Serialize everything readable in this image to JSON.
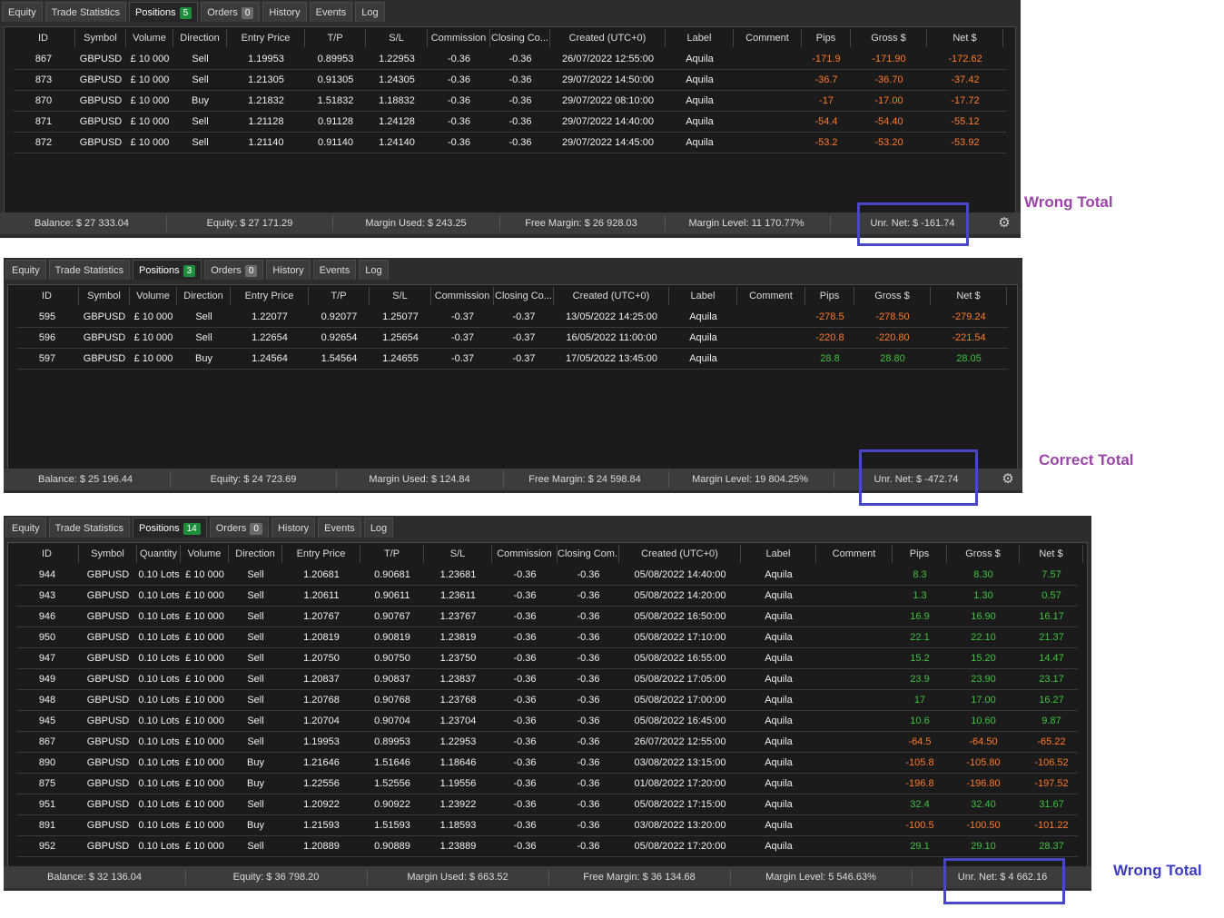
{
  "tab_labels": [
    "Equity",
    "Trade Statistics",
    "Positions",
    "Orders",
    "History",
    "Events",
    "Log"
  ],
  "panels": [
    {
      "positions_count": "5",
      "orders_count": "0",
      "columns": [
        "ID",
        "Symbol",
        "Volume",
        "Direction",
        "Entry Price",
        "T/P",
        "S/L",
        "Commission",
        "Closing Co...",
        "Created (UTC+0)",
        "Label",
        "Comment",
        "Pips",
        "Gross $",
        "Net $"
      ],
      "rows": [
        [
          "867",
          "GBPUSD",
          "£ 10 000",
          "Sell",
          "1.19953",
          "0.89953",
          "1.22953",
          "-0.36",
          "-0.36",
          "26/07/2022 12:55:00",
          "Aquila",
          "",
          "-171.9",
          "-171.90",
          "-172.62"
        ],
        [
          "873",
          "GBPUSD",
          "£ 10 000",
          "Sell",
          "1.21305",
          "0.91305",
          "1.24305",
          "-0.36",
          "-0.36",
          "29/07/2022 14:50:00",
          "Aquila",
          "",
          "-36.7",
          "-36.70",
          "-37.42"
        ],
        [
          "870",
          "GBPUSD",
          "£ 10 000",
          "Buy",
          "1.21832",
          "1.51832",
          "1.18832",
          "-0.36",
          "-0.36",
          "29/07/2022 08:10:00",
          "Aquila",
          "",
          "-17",
          "-17.00",
          "-17.72"
        ],
        [
          "871",
          "GBPUSD",
          "£ 10 000",
          "Sell",
          "1.21128",
          "0.91128",
          "1.24128",
          "-0.36",
          "-0.36",
          "29/07/2022 14:40:00",
          "Aquila",
          "",
          "-54.4",
          "-54.40",
          "-55.12"
        ],
        [
          "872",
          "GBPUSD",
          "£ 10 000",
          "Sell",
          "1.21140",
          "0.91140",
          "1.24140",
          "-0.36",
          "-0.36",
          "29/07/2022 14:45:00",
          "Aquila",
          "",
          "-53.2",
          "-53.20",
          "-53.92"
        ]
      ],
      "status": [
        "Balance: $ 27 333.04",
        "Equity: $ 27 171.29",
        "Margin Used: $ 243.25",
        "Free Margin: $ 26 928.03",
        "Margin Level: 11 170.77%",
        "Unr. Net: $ -161.74"
      ],
      "annotation": "Wrong Total",
      "annotation_color": "#9b45a8"
    },
    {
      "positions_count": "3",
      "orders_count": "0",
      "columns": [
        "ID",
        "Symbol",
        "Volume",
        "Direction",
        "Entry Price",
        "T/P",
        "S/L",
        "Commission",
        "Closing Co...",
        "Created (UTC+0)",
        "Label",
        "Comment",
        "Pips",
        "Gross $",
        "Net $"
      ],
      "rows": [
        [
          "595",
          "GBPUSD",
          "£ 10 000",
          "Sell",
          "1.22077",
          "0.92077",
          "1.25077",
          "-0.37",
          "-0.37",
          "13/05/2022 14:25:00",
          "Aquila",
          "",
          "-278.5",
          "-278.50",
          "-279.24"
        ],
        [
          "596",
          "GBPUSD",
          "£ 10 000",
          "Sell",
          "1.22654",
          "0.92654",
          "1.25654",
          "-0.37",
          "-0.37",
          "16/05/2022 11:00:00",
          "Aquila",
          "",
          "-220.8",
          "-220.80",
          "-221.54"
        ],
        [
          "597",
          "GBPUSD",
          "£ 10 000",
          "Buy",
          "1.24564",
          "1.54564",
          "1.24655",
          "-0.37",
          "-0.37",
          "17/05/2022 13:45:00",
          "Aquila",
          "",
          "28.8",
          "28.80",
          "28.05"
        ]
      ],
      "status": [
        "Balance: $ 25 196.44",
        "Equity: $ 24 723.69",
        "Margin Used: $ 124.84",
        "Free Margin: $ 24 598.84",
        "Margin Level: 19 804.25%",
        "Unr. Net: $ -472.74"
      ],
      "annotation": "Correct Total",
      "annotation_color": "#9b45a8"
    },
    {
      "positions_count": "14",
      "orders_count": "0",
      "columns": [
        "ID",
        "Symbol",
        "Quantity",
        "Volume",
        "Direction",
        "Entry Price",
        "T/P",
        "S/L",
        "Commission",
        "Closing Com...",
        "Created (UTC+0)",
        "Label",
        "Comment",
        "Pips",
        "Gross $",
        "Net $"
      ],
      "rows": [
        [
          "944",
          "GBPUSD",
          "0.10 Lots",
          "£ 10 000",
          "Sell",
          "1.20681",
          "0.90681",
          "1.23681",
          "-0.36",
          "-0.36",
          "05/08/2022 14:40:00",
          "Aquila",
          "",
          "8.3",
          "8.30",
          "7.57"
        ],
        [
          "943",
          "GBPUSD",
          "0.10 Lots",
          "£ 10 000",
          "Sell",
          "1.20611",
          "0.90611",
          "1.23611",
          "-0.36",
          "-0.36",
          "05/08/2022 14:20:00",
          "Aquila",
          "",
          "1.3",
          "1.30",
          "0.57"
        ],
        [
          "946",
          "GBPUSD",
          "0.10 Lots",
          "£ 10 000",
          "Sell",
          "1.20767",
          "0.90767",
          "1.23767",
          "-0.36",
          "-0.36",
          "05/08/2022 16:50:00",
          "Aquila",
          "",
          "16.9",
          "16.90",
          "16.17"
        ],
        [
          "950",
          "GBPUSD",
          "0.10 Lots",
          "£ 10 000",
          "Sell",
          "1.20819",
          "0.90819",
          "1.23819",
          "-0.36",
          "-0.36",
          "05/08/2022 17:10:00",
          "Aquila",
          "",
          "22.1",
          "22.10",
          "21.37"
        ],
        [
          "947",
          "GBPUSD",
          "0.10 Lots",
          "£ 10 000",
          "Sell",
          "1.20750",
          "0.90750",
          "1.23750",
          "-0.36",
          "-0.36",
          "05/08/2022 16:55:00",
          "Aquila",
          "",
          "15.2",
          "15.20",
          "14.47"
        ],
        [
          "949",
          "GBPUSD",
          "0.10 Lots",
          "£ 10 000",
          "Sell",
          "1.20837",
          "0.90837",
          "1.23837",
          "-0.36",
          "-0.36",
          "05/08/2022 17:05:00",
          "Aquila",
          "",
          "23.9",
          "23.90",
          "23.17"
        ],
        [
          "948",
          "GBPUSD",
          "0.10 Lots",
          "£ 10 000",
          "Sell",
          "1.20768",
          "0.90768",
          "1.23768",
          "-0.36",
          "-0.36",
          "05/08/2022 17:00:00",
          "Aquila",
          "",
          "17",
          "17.00",
          "16.27"
        ],
        [
          "945",
          "GBPUSD",
          "0.10 Lots",
          "£ 10 000",
          "Sell",
          "1.20704",
          "0.90704",
          "1.23704",
          "-0.36",
          "-0.36",
          "05/08/2022 16:45:00",
          "Aquila",
          "",
          "10.6",
          "10.60",
          "9.87"
        ],
        [
          "867",
          "GBPUSD",
          "0.10 Lots",
          "£ 10 000",
          "Sell",
          "1.19953",
          "0.89953",
          "1.22953",
          "-0.36",
          "-0.36",
          "26/07/2022 12:55:00",
          "Aquila",
          "",
          "-64.5",
          "-64.50",
          "-65.22"
        ],
        [
          "890",
          "GBPUSD",
          "0.10 Lots",
          "£ 10 000",
          "Buy",
          "1.21646",
          "1.51646",
          "1.18646",
          "-0.36",
          "-0.36",
          "03/08/2022 13:15:00",
          "Aquila",
          "",
          "-105.8",
          "-105.80",
          "-106.52"
        ],
        [
          "875",
          "GBPUSD",
          "0.10 Lots",
          "£ 10 000",
          "Buy",
          "1.22556",
          "1.52556",
          "1.19556",
          "-0.36",
          "-0.36",
          "01/08/2022 17:20:00",
          "Aquila",
          "",
          "-196.8",
          "-196.80",
          "-197.52"
        ],
        [
          "951",
          "GBPUSD",
          "0.10 Lots",
          "£ 10 000",
          "Sell",
          "1.20922",
          "0.90922",
          "1.23922",
          "-0.36",
          "-0.36",
          "05/08/2022 17:15:00",
          "Aquila",
          "",
          "32.4",
          "32.40",
          "31.67"
        ],
        [
          "891",
          "GBPUSD",
          "0.10 Lots",
          "£ 10 000",
          "Buy",
          "1.21593",
          "1.51593",
          "1.18593",
          "-0.36",
          "-0.36",
          "03/08/2022 13:20:00",
          "Aquila",
          "",
          "-100.5",
          "-100.50",
          "-101.22"
        ],
        [
          "952",
          "GBPUSD",
          "0.10 Lots",
          "£ 10 000",
          "Sell",
          "1.20889",
          "0.90889",
          "1.23889",
          "-0.36",
          "-0.36",
          "05/08/2022 17:20:00",
          "Aquila",
          "",
          "29.1",
          "29.10",
          "28.37"
        ]
      ],
      "status": [
        "Balance: $ 32 136.04",
        "Equity: $ 36 798.20",
        "Margin Used: $ 663.52",
        "Free Margin: $ 36 134.68",
        "Margin Level: 5 546.63%",
        "Unr. Net: $ 4 662.16"
      ],
      "annotation": "Wrong Total",
      "annotation_color": "#3d3dbf"
    }
  ],
  "colors": {
    "negative": "#ff7a2a",
    "positive": "#3fc23f",
    "highlight_box": "#4747c8"
  },
  "icons": {
    "settings": "gear-icon"
  }
}
